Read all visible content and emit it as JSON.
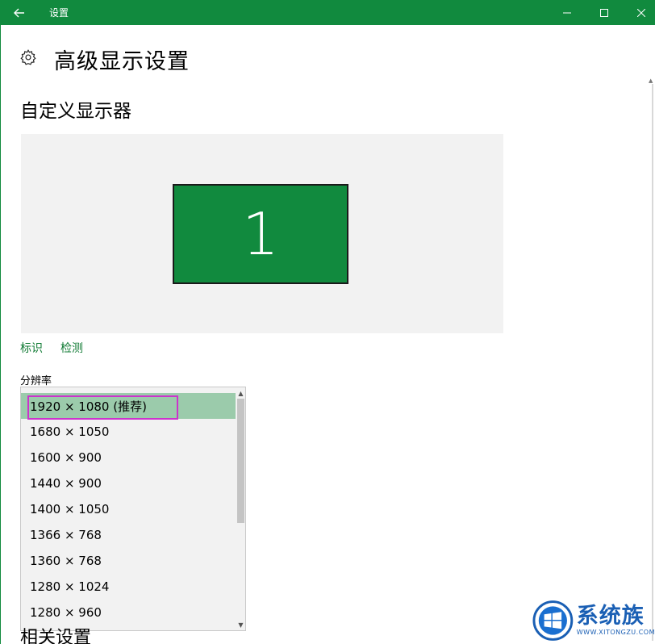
{
  "titlebar": {
    "title": "设置",
    "color": "#118a3e"
  },
  "header": {
    "title": "高级显示设置"
  },
  "section": {
    "title": "自定义显示器"
  },
  "arrangement": {
    "monitor_number": "1",
    "monitor_color": "#118a3e"
  },
  "links": {
    "identify": "标识",
    "detect": "检测"
  },
  "resolution": {
    "label": "分辨率",
    "options": [
      "1920 × 1080 (推荐)",
      "1680 × 1050",
      "1600 × 900",
      "1440 × 900",
      "1400 × 1050",
      "1366 × 768",
      "1360 × 768",
      "1280 × 1024",
      "1280 × 960"
    ],
    "selected": "1920 × 1080 (推荐)",
    "selected_color": "#9bcbab",
    "highlight_color": "#cc33cc"
  },
  "related": {
    "title": "相关设置"
  },
  "watermark": {
    "text_cn": "系统族",
    "text_en": "WWW.XITONGZU.COM"
  }
}
